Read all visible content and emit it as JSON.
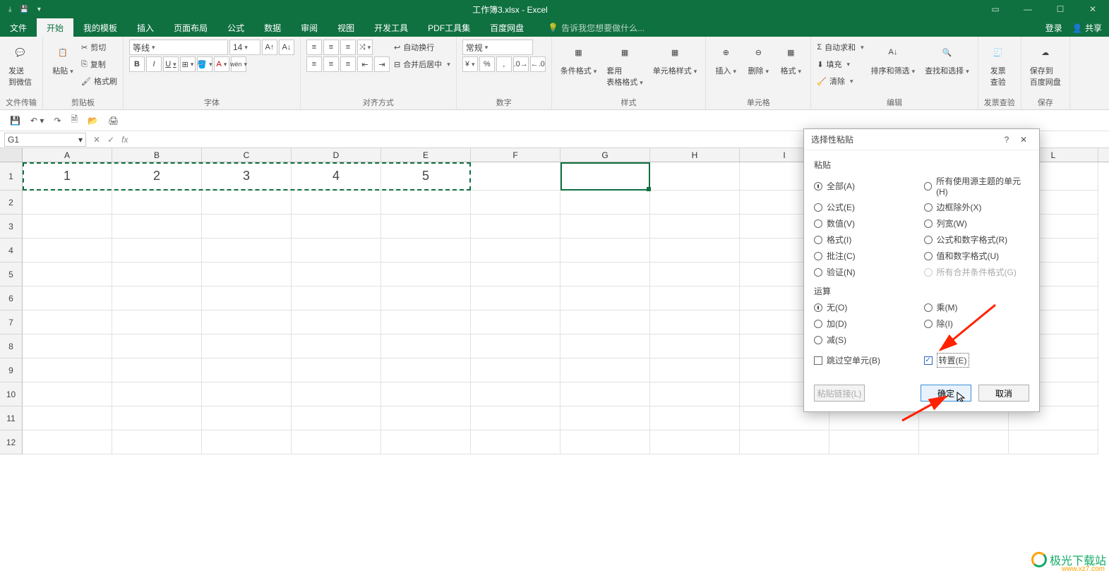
{
  "titlebar": {
    "app_title": "工作簿3.xlsx - Excel",
    "autosave_icon": "autosave",
    "save_icon": "save"
  },
  "ribbon_tabs": {
    "items": [
      "文件",
      "开始",
      "我的模板",
      "插入",
      "页面布局",
      "公式",
      "数据",
      "审阅",
      "视图",
      "开发工具",
      "PDF工具集",
      "百度网盘"
    ],
    "active": "开始",
    "tell_me": "告诉我您想要做什么...",
    "login": "登录",
    "share": "共享"
  },
  "ribbon": {
    "file_transfer": {
      "label": "文件传输",
      "send_wechat": "发送\n到微信"
    },
    "clipboard": {
      "label": "剪贴板",
      "paste": "粘贴",
      "cut": "剪切",
      "copy": "复制",
      "format_painter": "格式刷"
    },
    "font": {
      "label": "字体",
      "name": "等线",
      "size": "14",
      "bold": "B",
      "italic": "I",
      "underline": "U"
    },
    "align": {
      "label": "对齐方式",
      "wrap": "自动换行",
      "merge": "合并后居中"
    },
    "number": {
      "label": "数字",
      "format": "常规"
    },
    "style": {
      "label": "样式",
      "cond": "条件格式",
      "tbl": "套用\n表格格式",
      "cell": "单元格样式"
    },
    "cells": {
      "label": "单元格",
      "insert": "插入",
      "delete": "删除",
      "format": "格式"
    },
    "editing": {
      "label": "编辑",
      "sum": "自动求和",
      "fill": "填充",
      "clear": "清除",
      "sort": "排序和筛选",
      "find": "查找和选择"
    },
    "invoice": {
      "label": "发票查验",
      "btn": "发票\n查验"
    },
    "save": {
      "label": "保存",
      "btn": "保存到\n百度网盘"
    }
  },
  "formula_bar": {
    "name_box": "G1",
    "fx": "fx",
    "cancel": "✕",
    "ok": "✓"
  },
  "grid": {
    "columns": [
      "A",
      "B",
      "C",
      "D",
      "E",
      "F",
      "G",
      "H",
      "I",
      "J",
      "K",
      "L"
    ],
    "row1": [
      "1",
      "2",
      "3",
      "4",
      "5"
    ],
    "row_count": 12
  },
  "dialog": {
    "title": "选择性粘贴",
    "help": "?",
    "close": "✕",
    "section_paste": "粘贴",
    "paste_opts_left": [
      "全部(A)",
      "公式(E)",
      "数值(V)",
      "格式(I)",
      "批注(C)",
      "验证(N)"
    ],
    "paste_opts_right": [
      "所有使用源主题的单元(H)",
      "边框除外(X)",
      "列宽(W)",
      "公式和数字格式(R)",
      "值和数字格式(U)",
      "所有合并条件格式(G)"
    ],
    "paste_selected": "全部(A)",
    "section_op": "运算",
    "op_left": [
      "无(O)",
      "加(D)",
      "减(S)"
    ],
    "op_right": [
      "乘(M)",
      "除(I)"
    ],
    "op_selected": "无(O)",
    "skip_blanks": "跳过空单元(B)",
    "transpose": "转置(E)",
    "paste_link": "粘贴链接(L)",
    "ok": "确定",
    "cancel": "取消"
  },
  "watermark": {
    "text": "极光下载站",
    "url": "www.xz7.com"
  }
}
